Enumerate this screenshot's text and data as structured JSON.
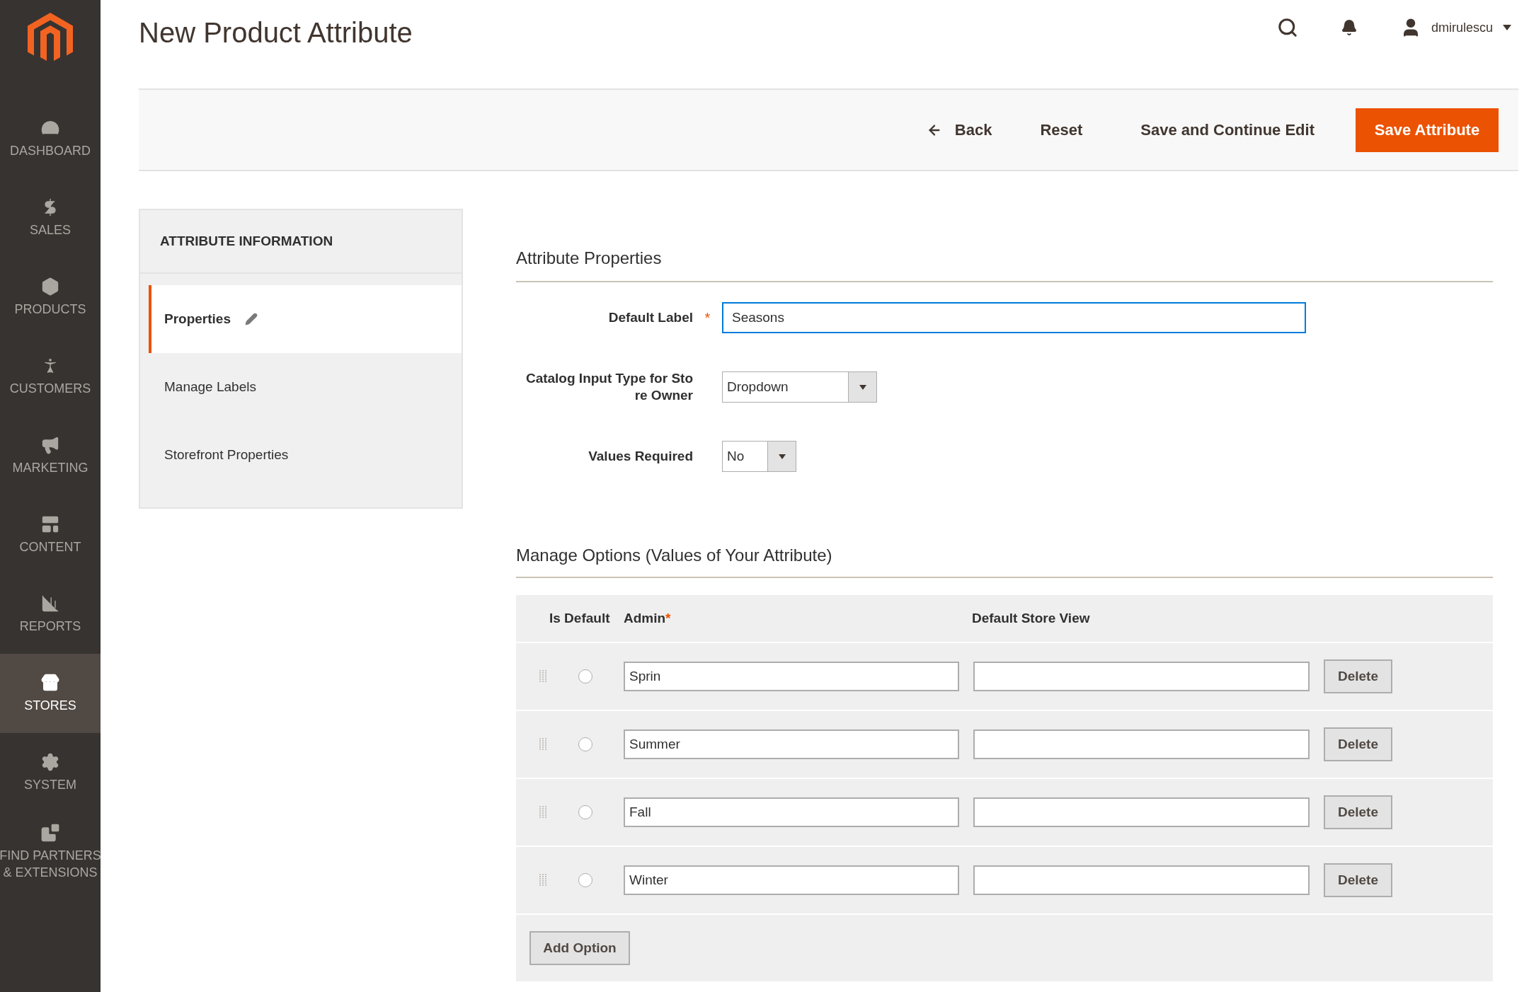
{
  "sidebar": {
    "items": [
      {
        "label": "DASHBOARD",
        "selected": false
      },
      {
        "label": "SALES",
        "selected": false
      },
      {
        "label": "PRODUCTS",
        "selected": false
      },
      {
        "label": "CUSTOMERS",
        "selected": false
      },
      {
        "label": "MARKETING",
        "selected": false
      },
      {
        "label": "CONTENT",
        "selected": false
      },
      {
        "label": "REPORTS",
        "selected": false
      },
      {
        "label": "STORES",
        "selected": true
      },
      {
        "label": "SYSTEM",
        "selected": false
      },
      {
        "label": "FIND PARTNERS & EXTENSIONS",
        "selected": false
      }
    ]
  },
  "header": {
    "title": "New Product Attribute",
    "user": "dmirulescu"
  },
  "actions": {
    "back": "Back",
    "reset": "Reset",
    "save_continue": "Save and Continue Edit",
    "save": "Save Attribute"
  },
  "tabs_panel": {
    "title": "ATTRIBUTE INFORMATION",
    "tabs": [
      {
        "label": "Properties",
        "selected": true
      },
      {
        "label": "Manage Labels",
        "selected": false
      },
      {
        "label": "Storefront Properties",
        "selected": false
      }
    ]
  },
  "attribute_properties": {
    "title": "Attribute Properties",
    "fields": [
      {
        "kind": "text",
        "label_lines": [
          "Default Label"
        ],
        "required_mark": "*",
        "value": "Seasons"
      },
      {
        "kind": "select",
        "label_lines": [
          "Catalog Input Type for Sto",
          "re Owner"
        ],
        "value": "Dropdown"
      },
      {
        "kind": "select_small",
        "label_lines": [
          "Values Required"
        ],
        "value": "No"
      }
    ]
  },
  "manage_options": {
    "title": "Manage Options (Values of Your Attribute)",
    "columns": [
      {
        "label": "Is Default"
      },
      {
        "label": "Admin",
        "required_mark": "*"
      },
      {
        "label": "Default Store View"
      }
    ],
    "rows": [
      {
        "is_default": false,
        "admin": "Sprin",
        "delete": "Delete"
      },
      {
        "is_default": false,
        "admin": "Summer",
        "delete": "Delete"
      },
      {
        "is_default": false,
        "admin": "Fall",
        "delete": "Delete"
      },
      {
        "is_default": false,
        "admin": "Winter",
        "delete": "Delete"
      }
    ],
    "add_option": "Add Option"
  }
}
